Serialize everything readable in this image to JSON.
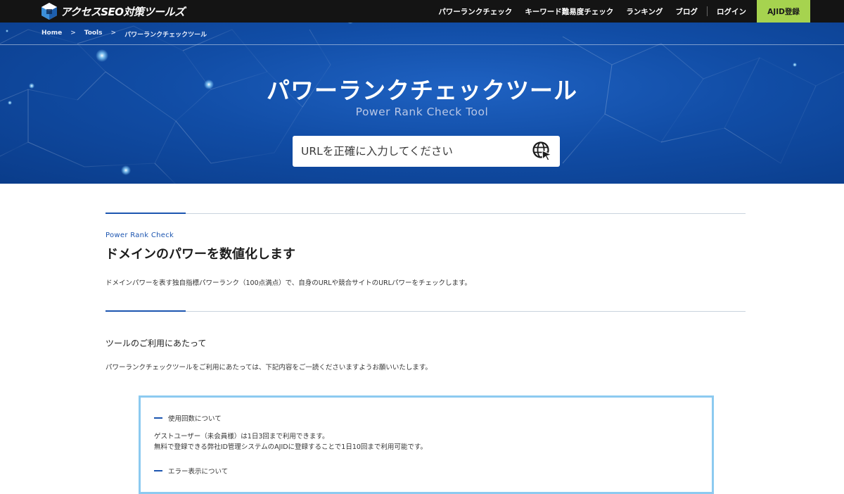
{
  "header": {
    "logo_text": "アクセスSEO対策ツールズ",
    "nav": [
      {
        "label": "パワーランクチェック"
      },
      {
        "label": "キーワード難易度チェック"
      },
      {
        "label": "ランキング"
      },
      {
        "label": "ブログ"
      },
      {
        "label": "ログイン"
      }
    ],
    "register_label": "AJID登録"
  },
  "breadcrumb": {
    "items": [
      "Home",
      "Tools",
      "パワーランクチェックツール"
    ],
    "separator": ">"
  },
  "hero": {
    "title": "パワーランクチェックツール",
    "subtitle": "Power Rank Check Tool",
    "url_placeholder": "URLを正確に入力してください",
    "search_icon": "globe-cursor-icon"
  },
  "section1": {
    "label_en": "Power Rank Check",
    "heading": "ドメインのパワーを数値化します",
    "description": "ドメインパワーを表す独自指標パワーランク（100点満点）で、自身のURLや競合サイトのURLパワーをチェックします。"
  },
  "section2": {
    "heading": "ツールのご利用にあたって",
    "description": "パワーランクチェックツールをご利用にあたっては、下記内容をご一読くださいますようお願いいたします。"
  },
  "notice": {
    "items": [
      {
        "title": "使用回数について",
        "lines": [
          "ゲストユーザー（未会員様）は1日3回まで利用できます。",
          "無料で登録できる弊社ID管理システムのAJIDに登録することで1日10回まで利用可能です。"
        ]
      },
      {
        "title": "エラー表示について",
        "lines": []
      }
    ]
  },
  "colors": {
    "topbar": "#141414",
    "hero_blue": "#114da6",
    "accent_blue": "#1c55b0",
    "register_green": "#a6d34f",
    "notice_border": "#8ccaf0"
  }
}
